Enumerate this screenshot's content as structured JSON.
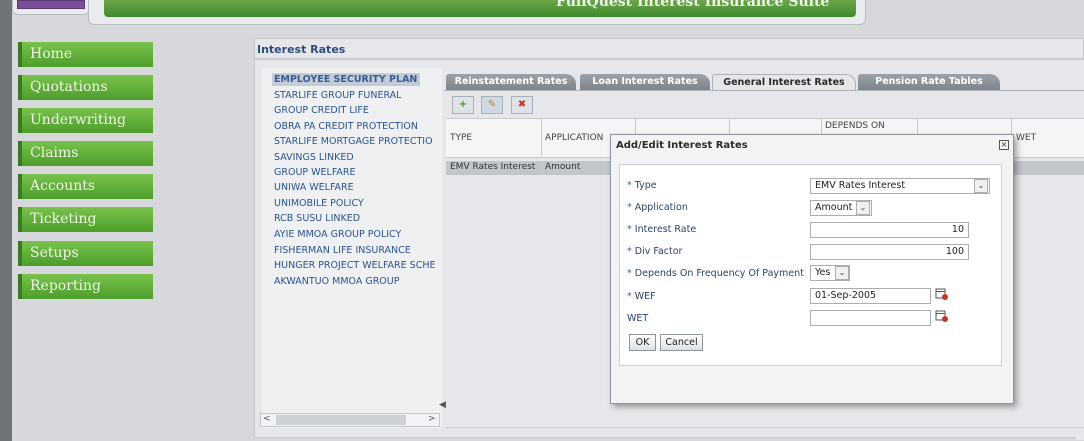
{
  "header": {
    "banner_text": "FullQuest Interest Insurance Suite"
  },
  "menu": [
    "Home",
    "Quotations",
    "Underwriting",
    "Claims",
    "Accounts",
    "Ticketing",
    "Setups",
    "Reporting"
  ],
  "panel": {
    "title": "Interest Rates"
  },
  "products": [
    "EMPLOYEE SECURITY PLAN",
    "STARLIFE GROUP FUNERAL",
    "GROUP CREDIT LIFE",
    "OBRA PA CREDIT PROTECTION",
    "STARLIFE MORTGAGE PROTECTIO",
    "SAVINGS LINKED",
    "GROUP WELFARE",
    "UNIWA WELFARE",
    "UNIMOBILE POLICY",
    "RCB SUSU LINKED",
    "AYIE MMOA GROUP POLICY",
    "FISHERMAN LIFE INSURANCE",
    "HUNGER PROJECT WELFARE SCHE",
    "AKWANTUO MMOA GROUP"
  ],
  "tabs": [
    "Reinstatement Rates",
    "Loan Interest Rates",
    "General Interest Rates",
    "Pension Rate Tables"
  ],
  "grid": {
    "headers": {
      "type": "TYPE",
      "application": "APPLICATION",
      "depends_on": "DEPENDS ON",
      "wet": "WET"
    },
    "row": {
      "type": "EMV Rates Interest",
      "application": "Amount"
    }
  },
  "dialog": {
    "title": "Add/Edit Interest Rates",
    "close": "×",
    "fields": {
      "type_label": "Type",
      "type_value": "EMV Rates Interest",
      "application_label": "Application",
      "application_value": "Amount",
      "interest_rate_label": "Interest Rate",
      "interest_rate_value": "10",
      "div_factor_label": "Div Factor",
      "div_factor_value": "100",
      "depends_label": "Depends On Frequency Of Payment",
      "depends_value": "Yes",
      "wef_label": "WEF",
      "wef_value": "01-Sep-2005",
      "wet_label": "WET",
      "wet_value": ""
    },
    "buttons": {
      "ok": "OK",
      "cancel": "Cancel"
    }
  },
  "misc": {
    "req_mark": "*",
    "dd_arrow": "⌄",
    "scroll_left": "<",
    "scroll_right": ">",
    "add": "+",
    "edit": "✎",
    "delete": "✖",
    "splitter": "◀"
  },
  "colors": {
    "menu_green": "#5fae39",
    "title_blue": "#2d4e79",
    "link_blue": "#2c5490"
  }
}
